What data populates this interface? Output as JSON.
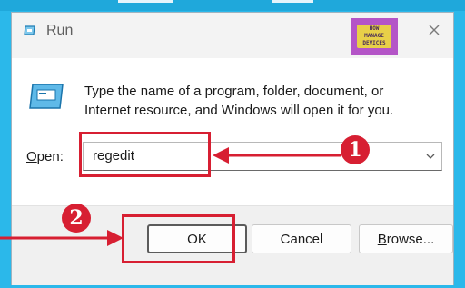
{
  "window": {
    "title": "Run",
    "close_icon": "close-icon",
    "app_icon": "run-app-icon"
  },
  "logo": {
    "text_line1": "HOW",
    "text_line2": "TO",
    "text_line3": "MANAGE",
    "text_line4": "DEVICES"
  },
  "dialog": {
    "description_line1": "Type the name of a program, folder, document, or",
    "description_line2": "Internet resource, and Windows will open it for you.",
    "open_label_prefix": "O",
    "open_label_rest": "pen:",
    "open_value": "regedit"
  },
  "buttons": {
    "ok": "OK",
    "cancel": "Cancel",
    "browse_prefix": "B",
    "browse_rest": "rowse..."
  },
  "annotations": {
    "step1": "1",
    "step2": "2",
    "highlight_color": "#d71f32"
  }
}
